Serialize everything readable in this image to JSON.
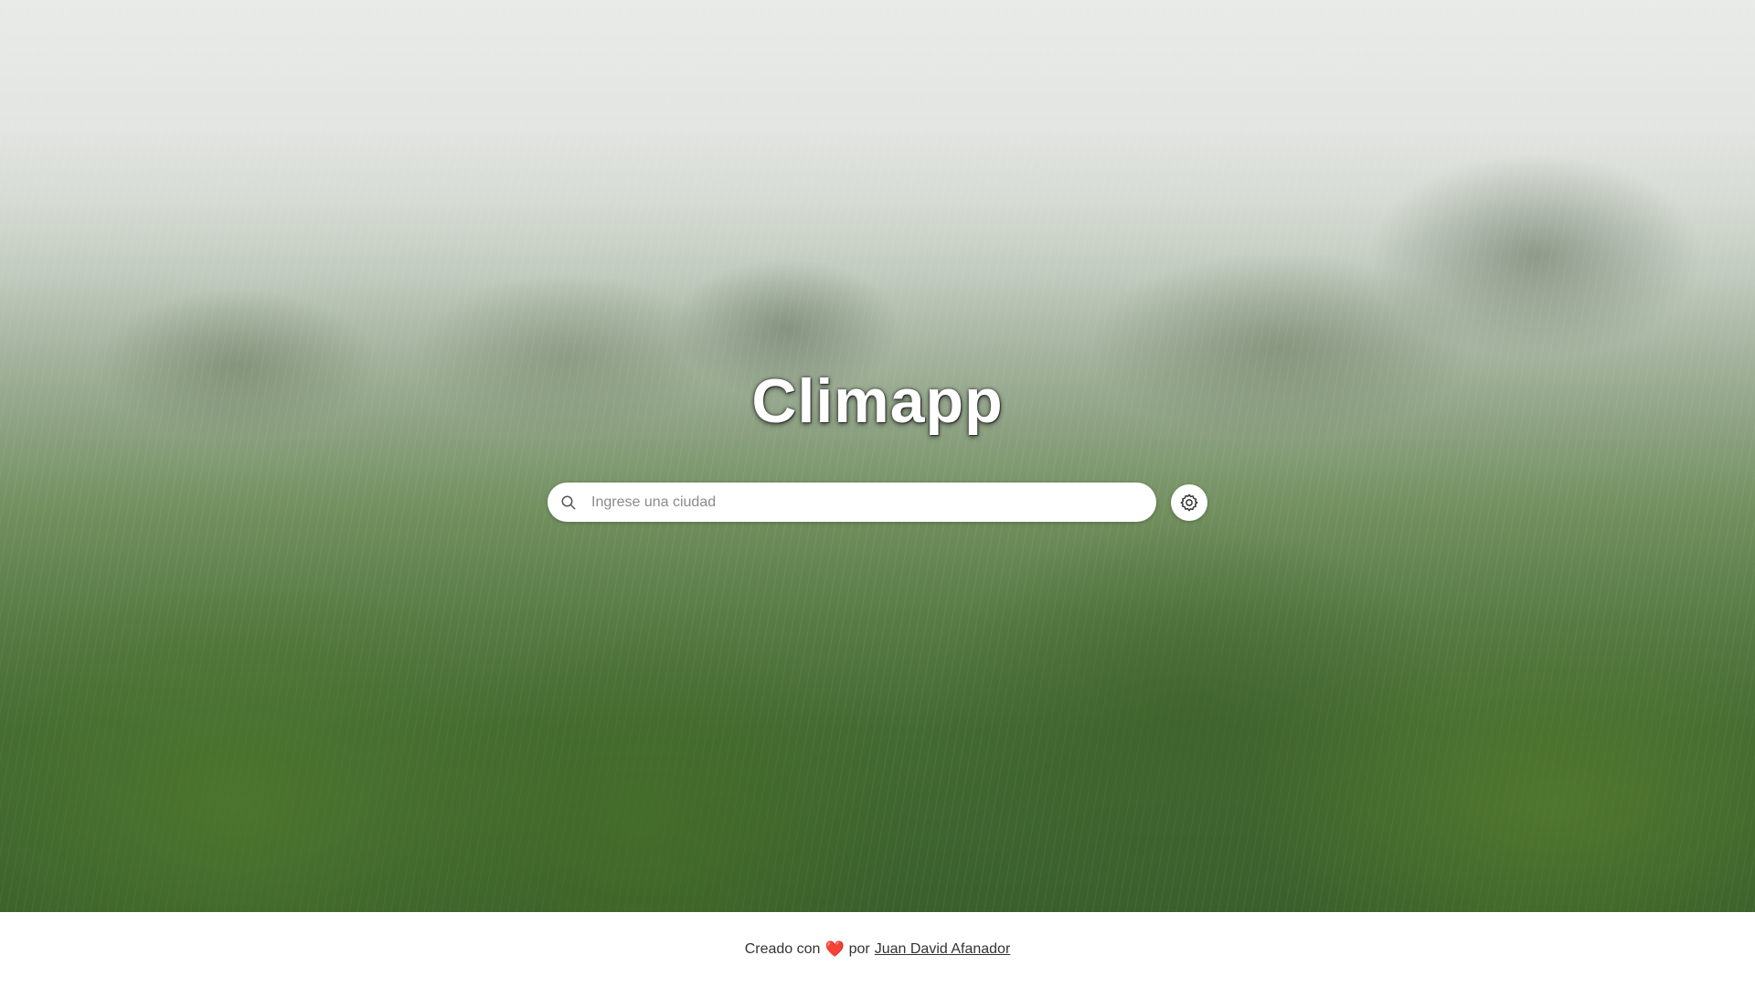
{
  "app": {
    "title": "Climapp"
  },
  "search": {
    "placeholder": "Ingrese una ciudad",
    "value": "",
    "icon": "search-icon"
  },
  "settings": {
    "icon": "gear-icon"
  },
  "footer": {
    "prefix": "Creado con",
    "heart": "❤️",
    "by": "por",
    "author_link": "Juan David Afanador"
  },
  "colors": {
    "title_text": "#ffffff",
    "footer_text": "#333333",
    "heart": "#e0245e"
  }
}
